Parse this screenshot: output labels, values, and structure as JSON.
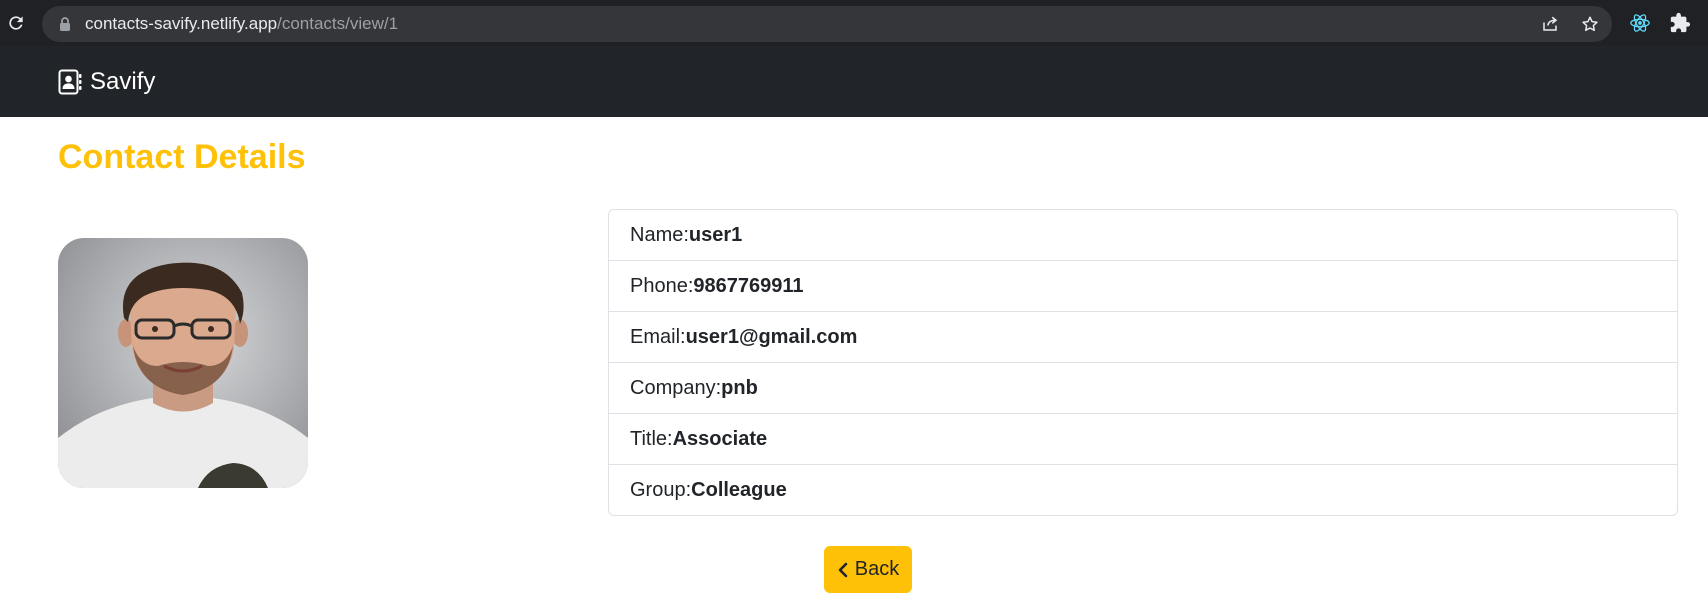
{
  "browser": {
    "url_host": "contacts-savify.netlify.app",
    "url_path": "/contacts/view/1"
  },
  "navbar": {
    "brand": "Savify",
    "brand_icon": "address-book-icon"
  },
  "page": {
    "title": "Contact Details"
  },
  "contact": {
    "fields": [
      {
        "label": "Name:",
        "value": "user1"
      },
      {
        "label": "Phone:",
        "value": "9867769911"
      },
      {
        "label": "Email:",
        "value": "user1@gmail.com"
      },
      {
        "label": "Company:",
        "value": "pnb"
      },
      {
        "label": "Title:",
        "value": "Associate"
      },
      {
        "label": "Group:",
        "value": "Colleague"
      }
    ]
  },
  "actions": {
    "back_label": "Back",
    "back_icon": "chevron-left-icon"
  },
  "colors": {
    "accent": "#ffc107",
    "navbar_bg": "#212529",
    "border": "#dee2e6"
  }
}
